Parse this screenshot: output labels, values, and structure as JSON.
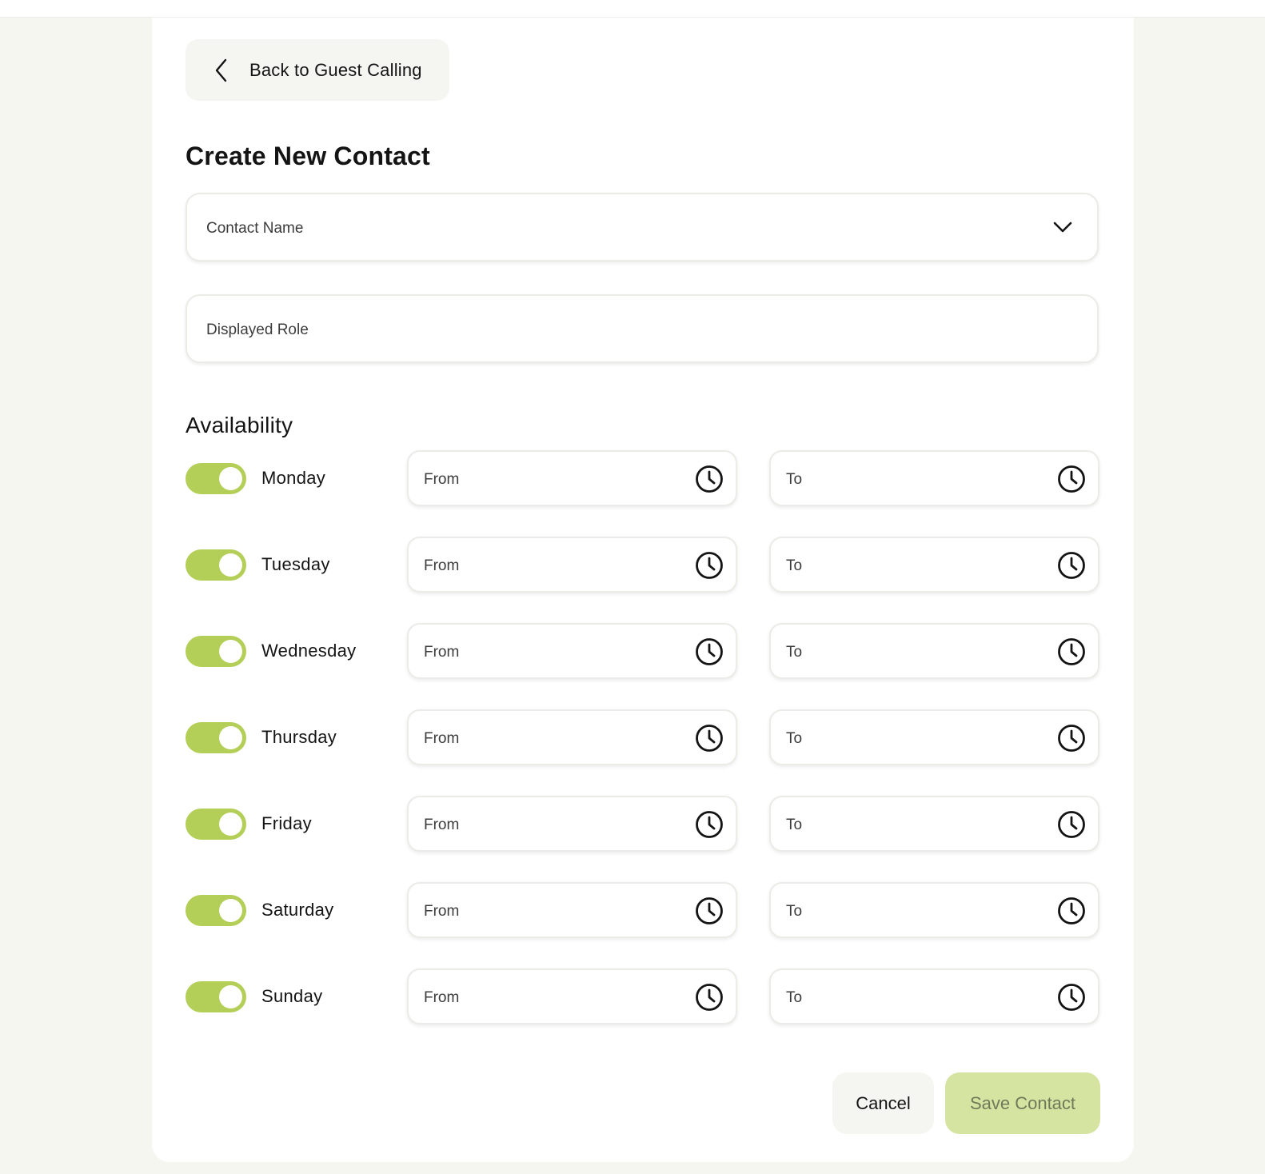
{
  "header": {
    "back_label": "Back to Guest Calling",
    "title": "Create New Contact"
  },
  "form": {
    "contact_name_placeholder": "Contact Name",
    "displayed_role_placeholder": "Displayed Role"
  },
  "availability": {
    "title": "Availability",
    "from_placeholder": "From",
    "to_placeholder": "To",
    "days": [
      {
        "label": "Monday",
        "enabled": true
      },
      {
        "label": "Tuesday",
        "enabled": true
      },
      {
        "label": "Wednesday",
        "enabled": true
      },
      {
        "label": "Thursday",
        "enabled": true
      },
      {
        "label": "Friday",
        "enabled": true
      },
      {
        "label": "Saturday",
        "enabled": true
      },
      {
        "label": "Sunday",
        "enabled": true
      }
    ]
  },
  "actions": {
    "cancel_label": "Cancel",
    "save_label": "Save Contact"
  },
  "colors": {
    "accent": "#b3cf57",
    "save_disabled_bg": "#d6e4a1",
    "page_bg": "#f6f6f1"
  }
}
